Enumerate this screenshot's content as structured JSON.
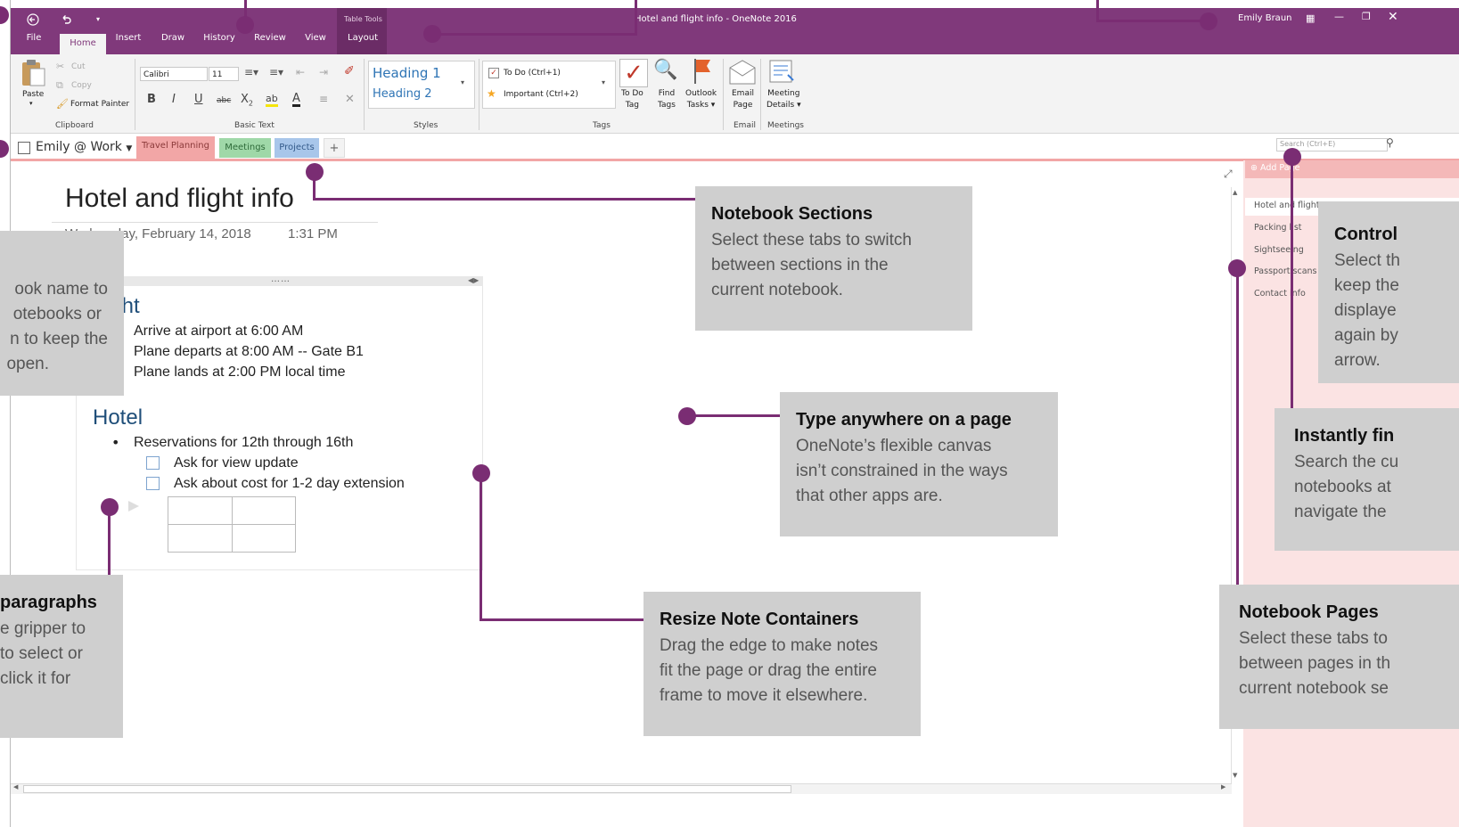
{
  "titlebar": {
    "table_tools": "Table Tools",
    "window_title": "Hotel and flight info  -  OneNote 2016",
    "user": "Emily Braun"
  },
  "menu_tabs": [
    "File",
    "Home",
    "Insert",
    "Draw",
    "History",
    "Review",
    "View",
    "Layout"
  ],
  "ribbon": {
    "paste": "Paste",
    "cut": "Cut",
    "copy": "Copy",
    "format_painter": "Format Painter",
    "clipboard_label": "Clipboard",
    "font_name": "Calibri",
    "font_size": "11",
    "basic_text_label": "Basic Text",
    "heading1": "Heading 1",
    "heading2": "Heading 2",
    "styles_label": "Styles",
    "todo": "To Do (Ctrl+1)",
    "important": "Important (Ctrl+2)",
    "todo_tag": [
      "To Do",
      "Tag"
    ],
    "find_tags": [
      "Find",
      "Tags"
    ],
    "outlook_tasks": [
      "Outlook",
      "Tasks"
    ],
    "tags_label": "Tags",
    "email_page": [
      "Email",
      "Page"
    ],
    "email_label": "Email",
    "meeting_details": [
      "Meeting",
      "Details"
    ],
    "meetings_label": "Meetings"
  },
  "notebook": {
    "name": "Emily @ Work",
    "sections": [
      "Travel Planning",
      "Meetings",
      "Projects"
    ],
    "add_section": "+",
    "search_placeholder": "Search (Ctrl+E)"
  },
  "pages": {
    "add_page": "Add Page",
    "items": [
      "Hotel and flight",
      "Packing list",
      "Sightseeing",
      "Passport scans",
      "Contact info"
    ]
  },
  "note": {
    "title": "Hotel and flight info",
    "date": "Wednesday, February 14, 2018",
    "time": "1:31 PM",
    "flight_heading": "Flight",
    "flight_items": [
      "Arrive at airport at 6:00 AM",
      "Plane departs at 8:00 AM -- Gate B1",
      "Plane lands at 2:00 PM local time"
    ],
    "hotel_heading": "Hotel",
    "hotel_bullet": "Reservations for 12th through 16th",
    "hotel_todos": [
      "Ask for view update",
      "Ask about cost for 1-2 day extension"
    ]
  },
  "callouts": {
    "sections": {
      "title": "Notebook Sections",
      "body": [
        "Select these tabs to switch",
        "between sections in the",
        "current notebook."
      ]
    },
    "type_anywhere": {
      "title": "Type anywhere on a page",
      "body": [
        "OneNote’s flexible canvas",
        "isn’t constrained in the ways",
        "that other apps are."
      ]
    },
    "resize": {
      "title": "Resize Note Containers",
      "body": [
        "Drag the edge to make notes",
        "fit the page or drag the entire",
        "frame to move it elsewhere."
      ]
    },
    "pages": {
      "title": "Notebook Pages",
      "body": [
        "Select these tabs to",
        "between pages in th",
        "current notebook se"
      ]
    },
    "find": {
      "title": "Instantly fin",
      "body": [
        "Search the cu",
        "notebooks at",
        "navigate the"
      ]
    },
    "control": {
      "title": "Control",
      "body": [
        "Select th",
        "keep the",
        "displaye",
        "again by",
        "arrow."
      ]
    },
    "notebook_name": {
      "body": [
        "ook name to",
        "otebooks or",
        "n to keep the",
        "open."
      ]
    },
    "paragraphs": {
      "title": "paragraphs",
      "body": [
        "e gripper to",
        "to select or",
        "click it for"
      ]
    }
  },
  "colors": {
    "accent": "#80397b",
    "line": "#7a2d73",
    "callout_bg": "#cfcfcf",
    "page_panel": "#fbe3e3"
  }
}
